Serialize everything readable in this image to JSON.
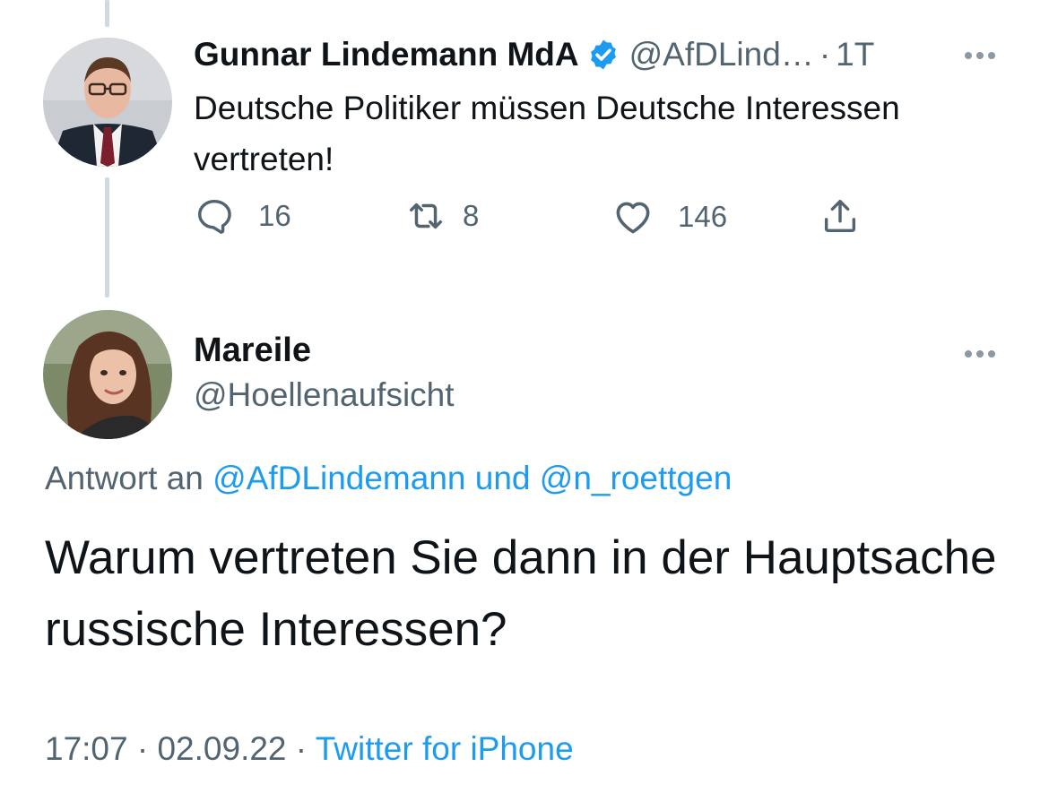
{
  "original_tweet": {
    "author_name": "Gunnar Lindemann MdA",
    "handle": "@AfDLind…",
    "separator": "·",
    "time": "1T",
    "text": "Deutsche Politiker müssen Deutsche Interessen vertreten!",
    "replies": "16",
    "retweets": "8",
    "likes": "146",
    "verified": true,
    "icons": [
      "reply-icon",
      "retweet-icon",
      "like-icon",
      "share-icon",
      "verified-badge-icon",
      "more-icon"
    ]
  },
  "reply_tweet": {
    "author_name": "Mareile",
    "handle": "@Hoellenaufsicht",
    "reply_prefix": "Antwort an",
    "reply_to_1": "@AfDLindemann",
    "reply_joiner": "und",
    "reply_to_2": "@n_roettgen",
    "text": "Warum vertreten Sie dann in der Hauptsache russische Interessen?",
    "time": "17:07",
    "date": "02.09.22",
    "separator": "·",
    "source": "Twitter for iPhone"
  },
  "colors": {
    "text_primary": "#0f1419",
    "text_secondary": "#536471",
    "link": "#1d9bf0",
    "thread_line": "#cfd9de",
    "verified": "#1d9bf0"
  }
}
